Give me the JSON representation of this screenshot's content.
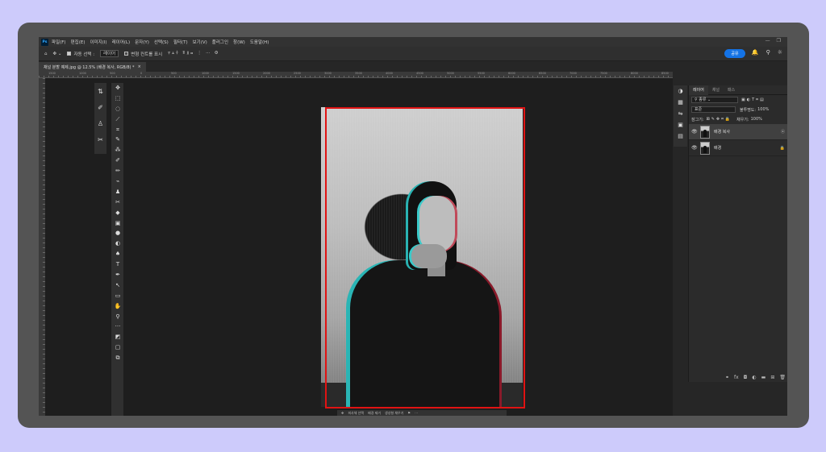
{
  "app": {
    "logo": "Ps"
  },
  "menu": [
    "파일(F)",
    "편집(E)",
    "이미지(I)",
    "레이어(L)",
    "문자(Y)",
    "선택(S)",
    "필터(T)",
    "보기(V)",
    "플러그인",
    "창(W)",
    "도움말(H)"
  ],
  "window_controls": [
    "—",
    "❐"
  ],
  "options": {
    "auto_select_label": "자동 선택 :",
    "auto_select_value": "레이어",
    "transform_label": "변형 컨트롤 표시",
    "share_label": "공유"
  },
  "document_tab": {
    "title": "채널 분할 예제.jpg @ 12.5% (배경 복사, RGB/8) *",
    "close": "×"
  },
  "ruler_ticks": [
    "1500",
    "1000",
    "500",
    "0",
    "500",
    "1000",
    "1500",
    "2000",
    "2500",
    "3000",
    "3500",
    "4000",
    "4500",
    "5000",
    "5500",
    "6000",
    "6500",
    "7000",
    "7500",
    "8000",
    "8500"
  ],
  "tools": [
    "✥",
    "⬚",
    "◌",
    "⟋",
    "⌗",
    "✎",
    "⁂",
    "✐",
    "✏",
    "⌁",
    "♟",
    "✂",
    "◆",
    "▣",
    "●",
    "◐",
    "♠",
    "T",
    "✒",
    "↖",
    "▭",
    "✋",
    "⚲",
    "···",
    "◩",
    "▢",
    "⧉"
  ],
  "side_tools": [
    "⇅",
    "✐",
    "♙",
    "✂"
  ],
  "panel_icons": [
    "◑",
    "▦",
    "⇋",
    "▣",
    "▤"
  ],
  "layers_panel": {
    "tabs": [
      "레이어",
      "채널",
      "패스"
    ],
    "filter_label": "종류",
    "blend_mode": "표준",
    "opacity_label": "불투명도:",
    "opacity_value": "100%",
    "lock_label": "잠그기:",
    "fill_label": "채우기:",
    "fill_value": "100%",
    "layers": [
      {
        "name": "배경 복사",
        "badge": "⦿"
      },
      {
        "name": "배경",
        "badge": "🔒"
      }
    ],
    "footer_icons": [
      "⚭",
      "fx",
      "◘",
      "◐",
      "▬",
      "⊞",
      "🗑"
    ]
  },
  "context_bar": [
    "✥",
    "피사체 선택",
    "배경 제거",
    "생성형 채우기",
    "⚑",
    "⋯"
  ]
}
